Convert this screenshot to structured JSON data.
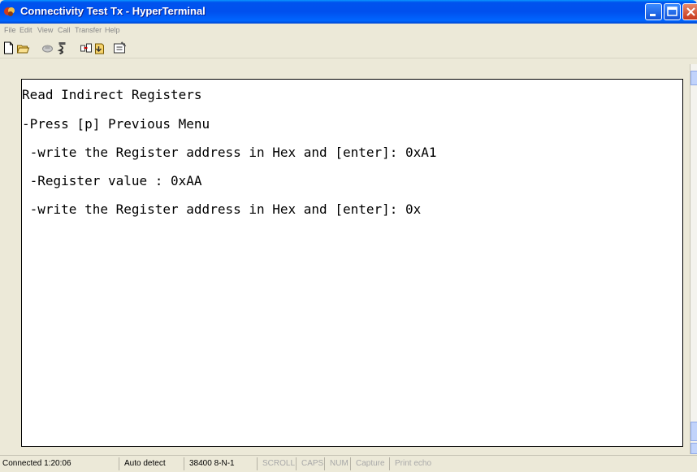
{
  "window": {
    "title": "Connectivity Test Tx - HyperTerminal",
    "icon": "hyperterminal-icon"
  },
  "menu": [
    "File",
    "Edit",
    "View",
    "Call",
    "Transfer",
    "Help"
  ],
  "toolbar": [
    "new-icon",
    "open-icon",
    "disconnect-icon",
    "dial-icon",
    "send-icon",
    "receive-icon",
    "properties-icon"
  ],
  "terminal": {
    "lines": [
      "Read Indirect Registers",
      "-Press [p] Previous Menu",
      " -write the Register address in Hex and [enter]: 0xA1",
      " -Register value : 0xAA",
      " -write the Register address in Hex and [enter]: 0x"
    ]
  },
  "status": {
    "connected": "Connected 1:20:06",
    "detect": "Auto detect",
    "settings": "38400 8-N-1",
    "scroll": "SCROLL",
    "caps": "CAPS",
    "num": "NUM",
    "capture": "Capture",
    "print_echo": "Print echo"
  },
  "colors": {
    "title_bar": "#0054e3",
    "terminal_bg": "#ffffff",
    "close_button": "#c7371a"
  }
}
